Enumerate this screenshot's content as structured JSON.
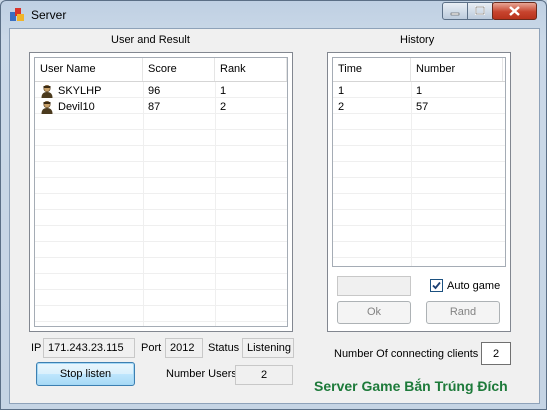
{
  "window": {
    "title": "Server"
  },
  "users_panel": {
    "title": "User and Result",
    "columns": [
      "User Name",
      "Score",
      "Rank"
    ],
    "rows": [
      {
        "name": "SKYLHP",
        "score": "96",
        "rank": "1",
        "icon": "user-icon"
      },
      {
        "name": "Devil10",
        "score": "87",
        "rank": "2",
        "icon": "user-icon"
      }
    ]
  },
  "history_panel": {
    "title": "History",
    "columns": [
      "Time",
      "Number"
    ],
    "rows": [
      {
        "time": "1",
        "number": "1"
      },
      {
        "time": "2",
        "number": "57"
      }
    ]
  },
  "controls": {
    "auto_game_label": "Auto game",
    "auto_game_checked": true,
    "ok_label": "Ok",
    "rand_label": "Rand"
  },
  "status_bar": {
    "ip_label": "IP",
    "ip_value": "171.243.23.115",
    "port_label": "Port",
    "port_value": "2012",
    "status_label": "Status",
    "status_value": "Listening",
    "connecting_label": "Number Of connecting clients",
    "connecting_value": "2",
    "stop_label": "Stop listen",
    "users_label": "Number Users",
    "users_value": "2",
    "brand_text": "Server Game Bắn Trúng Đích"
  },
  "colors": {
    "brand": "#1d7a3a",
    "close_button": "#c7442e"
  }
}
